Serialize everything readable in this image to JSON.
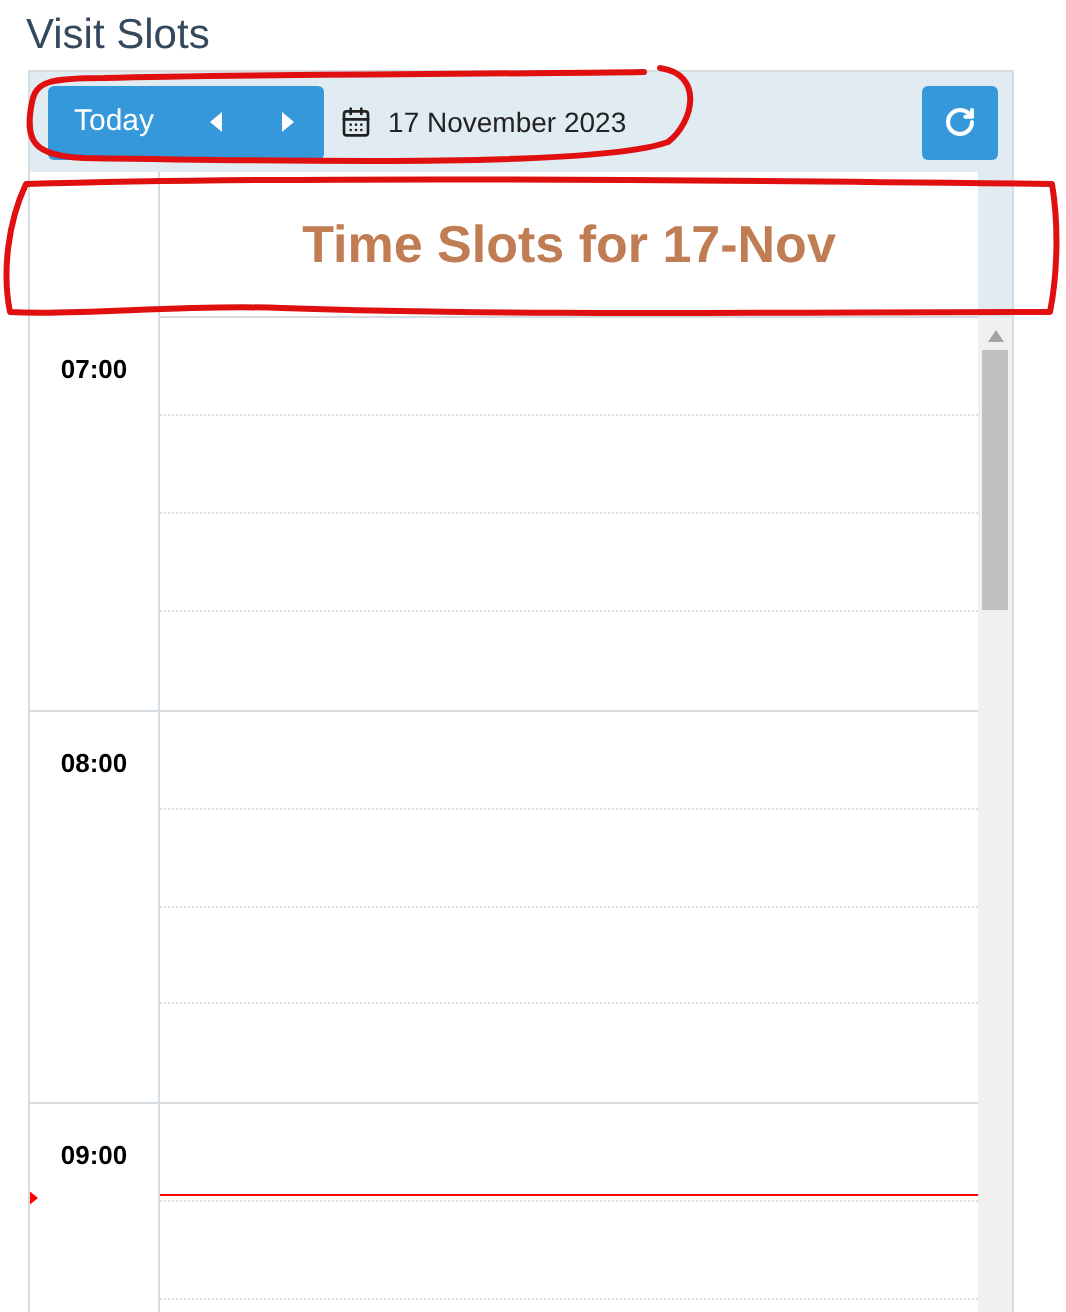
{
  "page_title": "Visit Slots",
  "toolbar": {
    "today_button": "Today",
    "date_label": "17 November 2023"
  },
  "day_header": "Time Slots for 17-Nov",
  "hours": [
    {
      "label": "07:00",
      "now_line": false
    },
    {
      "label": "08:00",
      "now_line": false
    },
    {
      "label": "09:00",
      "now_line": true
    }
  ]
}
